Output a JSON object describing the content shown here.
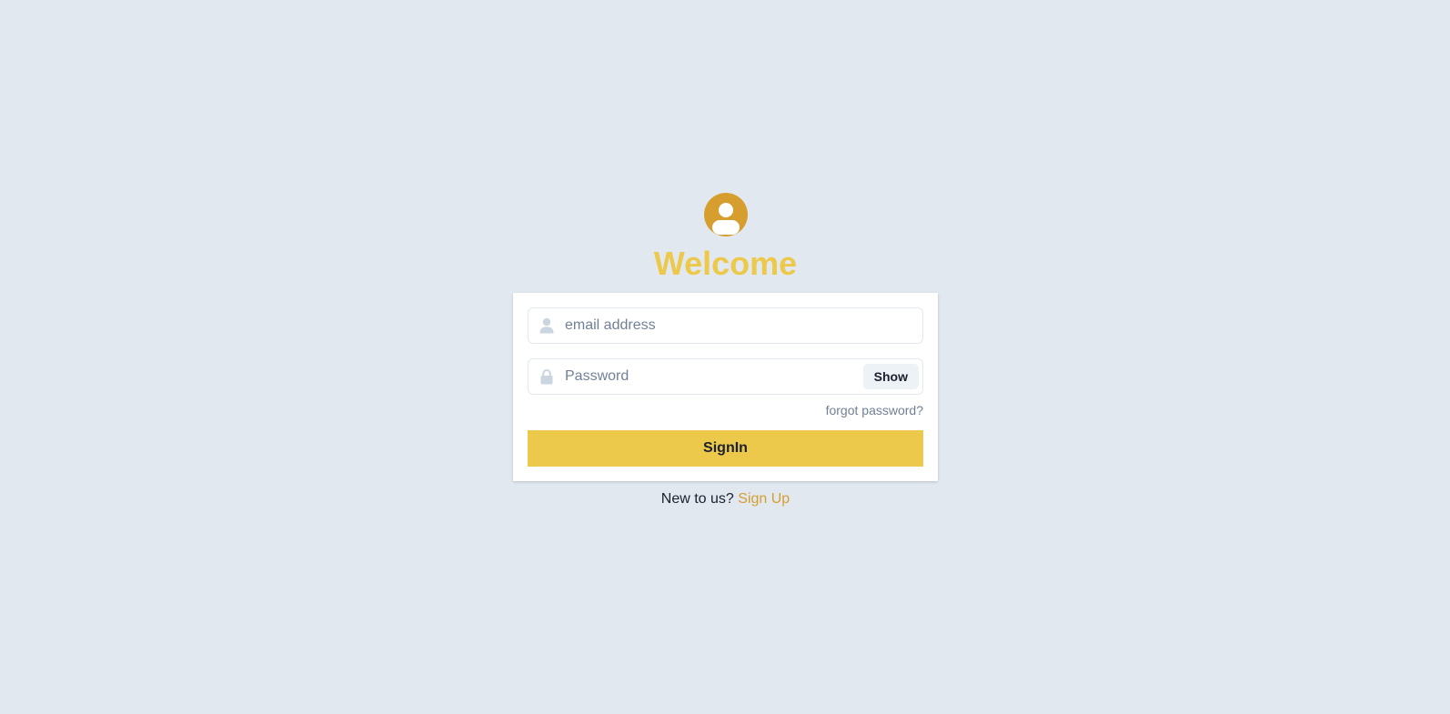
{
  "header": {
    "title": "Welcome",
    "avatar_icon": "user-circle-icon",
    "avatar_color": "#d69e2e",
    "title_color": "#ecc94b"
  },
  "form": {
    "email": {
      "placeholder": "email address",
      "value": "",
      "icon": "user-icon"
    },
    "password": {
      "placeholder": "Password",
      "value": "",
      "icon": "lock-icon",
      "toggle_label": "Show"
    },
    "forgot_password_label": "forgot password?",
    "submit_label": "SignIn",
    "submit_color": "#ecc94b"
  },
  "footer": {
    "prompt": "New to us?",
    "signup_label": "Sign Up",
    "signup_color": "#d69e2e"
  },
  "background_color": "#e2e8f0"
}
